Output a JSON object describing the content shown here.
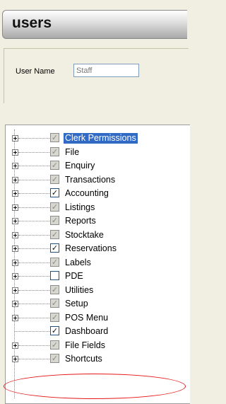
{
  "header": {
    "title": "users"
  },
  "form": {
    "user_name_label": "User Name",
    "user_name_value": "Staff"
  },
  "tree": {
    "items": [
      {
        "label": "Clerk Permissions",
        "state": "partial",
        "expander": true,
        "selected": true
      },
      {
        "label": "File",
        "state": "partial",
        "expander": true,
        "selected": false
      },
      {
        "label": "Enquiry",
        "state": "partial",
        "expander": true,
        "selected": false
      },
      {
        "label": "Transactions",
        "state": "partial",
        "expander": true,
        "selected": false
      },
      {
        "label": "Accounting",
        "state": "checked",
        "expander": true,
        "selected": false
      },
      {
        "label": "Listings",
        "state": "partial",
        "expander": true,
        "selected": false
      },
      {
        "label": "Reports",
        "state": "partial",
        "expander": true,
        "selected": false
      },
      {
        "label": "Stocktake",
        "state": "partial",
        "expander": true,
        "selected": false
      },
      {
        "label": "Reservations",
        "state": "checked",
        "expander": true,
        "selected": false
      },
      {
        "label": "Labels",
        "state": "partial",
        "expander": true,
        "selected": false
      },
      {
        "label": "PDE",
        "state": "unchecked",
        "expander": true,
        "selected": false
      },
      {
        "label": "Utilities",
        "state": "partial",
        "expander": true,
        "selected": false
      },
      {
        "label": "Setup",
        "state": "partial",
        "expander": true,
        "selected": false
      },
      {
        "label": "POS Menu",
        "state": "partial",
        "expander": true,
        "selected": false
      },
      {
        "label": "Dashboard",
        "state": "checked",
        "expander": false,
        "selected": false
      },
      {
        "label": "File Fields",
        "state": "partial",
        "expander": true,
        "selected": false
      },
      {
        "label": "Shortcuts",
        "state": "partial",
        "expander": true,
        "selected": false
      }
    ]
  },
  "colors": {
    "selection": "#316ac5",
    "annotation": "#e41616",
    "check_green": "#21a121"
  }
}
